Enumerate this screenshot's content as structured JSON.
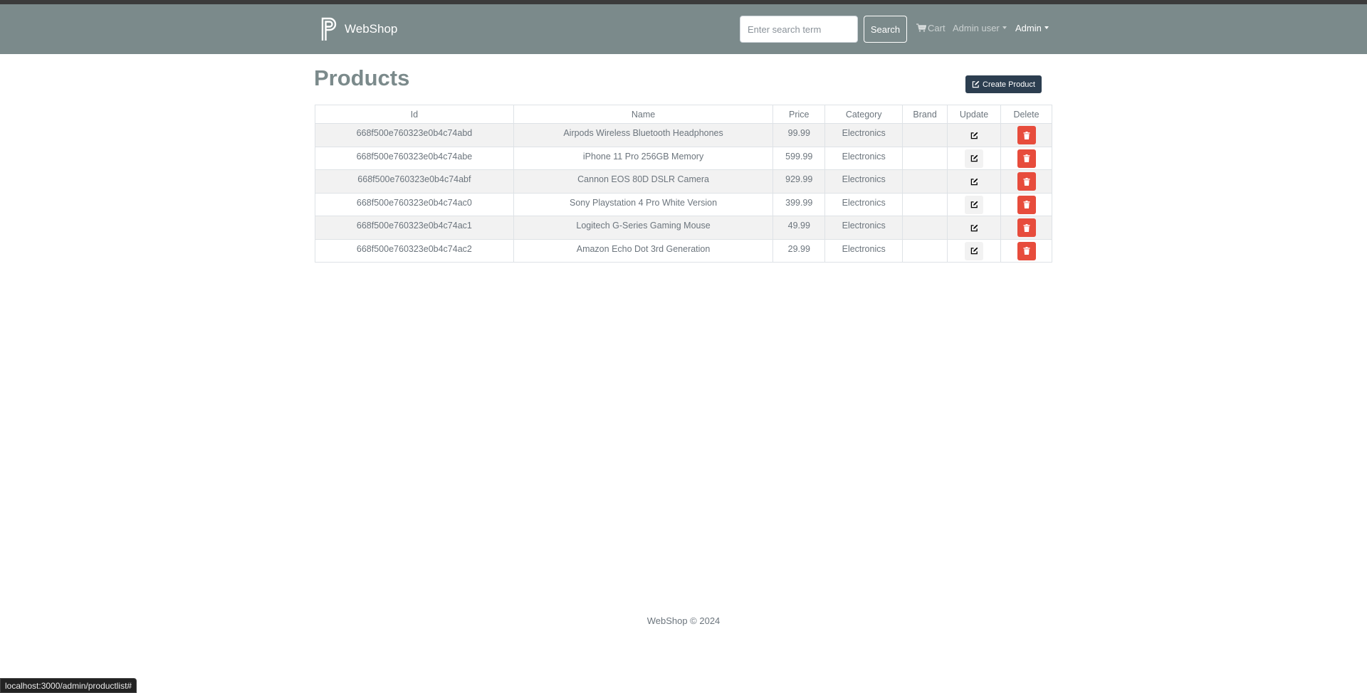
{
  "colors": {
    "navbar": "#7b8a8b",
    "primary": "#2c3e50",
    "danger": "#e74c3c"
  },
  "navbar": {
    "brand": "WebShop",
    "search_placeholder": "Enter search term",
    "search_label": "Search",
    "cart_label": "Cart",
    "user_label": "Admin user",
    "admin_label": "Admin"
  },
  "main": {
    "title": "Products",
    "create_label": "Create Product"
  },
  "table": {
    "headers": [
      "Id",
      "Name",
      "Price",
      "Category",
      "Brand",
      "Update",
      "Delete"
    ],
    "rows": [
      {
        "id": "668f500e760323e0b4c74abd",
        "name": "Airpods Wireless Bluetooth Headphones",
        "price": "99.99",
        "category": "Electronics",
        "brand": ""
      },
      {
        "id": "668f500e760323e0b4c74abe",
        "name": "iPhone 11 Pro 256GB Memory",
        "price": "599.99",
        "category": "Electronics",
        "brand": ""
      },
      {
        "id": "668f500e760323e0b4c74abf",
        "name": "Cannon EOS 80D DSLR Camera",
        "price": "929.99",
        "category": "Electronics",
        "brand": ""
      },
      {
        "id": "668f500e760323e0b4c74ac0",
        "name": "Sony Playstation 4 Pro White Version",
        "price": "399.99",
        "category": "Electronics",
        "brand": ""
      },
      {
        "id": "668f500e760323e0b4c74ac1",
        "name": "Logitech G-Series Gaming Mouse",
        "price": "49.99",
        "category": "Electronics",
        "brand": ""
      },
      {
        "id": "668f500e760323e0b4c74ac2",
        "name": "Amazon Echo Dot 3rd Generation",
        "price": "29.99",
        "category": "Electronics",
        "brand": ""
      }
    ]
  },
  "footer": {
    "text": "WebShop © 2024"
  },
  "status_bar": {
    "url": "localhost:3000/admin/productlist#"
  }
}
